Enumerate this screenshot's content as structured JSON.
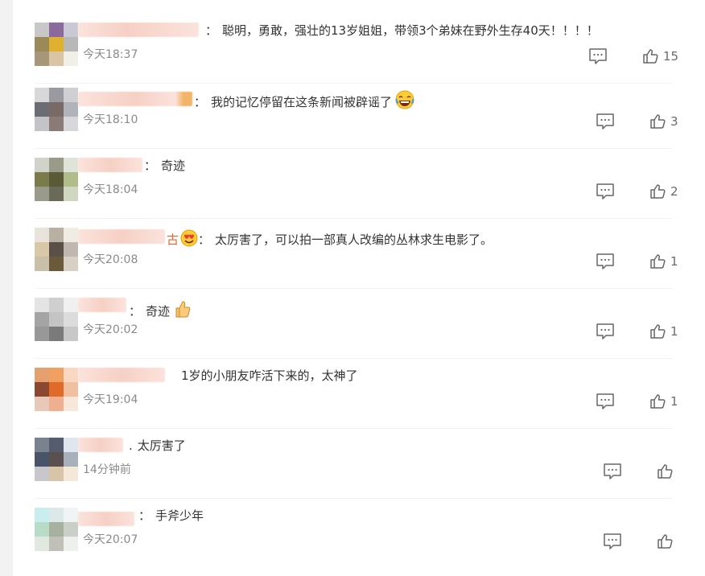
{
  "comments": [
    {
      "text": "聪明，勇敢，强壮的13岁姐姐，带领3个弟妹在野外生存40天！！！！",
      "time": "今天18:37",
      "likes": "15",
      "avatar_colors": [
        "#c8c8c8",
        "#8a6a9a",
        "#c9c9d6",
        "#9a8a5a",
        "#e0b030",
        "#b8b8b8",
        "#a8967a",
        "#d9c4a4",
        "#f0efe8"
      ],
      "name_blur_colors": [
        "#f6d6cc",
        "#fbe3dc"
      ]
    },
    {
      "text": "我的记忆停留在这条新闻被辟谣了",
      "emoji": "laugh-cry-emoji",
      "time": "今天18:10",
      "likes": "3",
      "avatar_colors": [
        "#d8d8d8",
        "#9a9aa0",
        "#d0d0d4",
        "#6a6e74",
        "#7a6a66",
        "#b0b4ba",
        "#c4c4c8",
        "#8a7a78",
        "#d8d8dc"
      ],
      "name_blur_colors": [
        "#f6d6cc",
        "#f3b46a"
      ]
    },
    {
      "text": "奇迹",
      "time": "今天18:04",
      "likes": "2",
      "avatar_colors": [
        "#d0d4c8",
        "#9a9a88",
        "#e0e4d8",
        "#7a7a4a",
        "#5a5a38",
        "#b0bc8a",
        "#9a9a8a",
        "#6a6a58",
        "#cfd7c0"
      ],
      "name_blur_colors": [
        "#f6d6cc",
        "#fbe3dc"
      ]
    },
    {
      "text": "太厉害了，可以拍一部真人改编的丛林求生电影了。",
      "prefix": "古",
      "prefix_emoji": "heart-eyes-emoji",
      "time": "今天20:08",
      "likes": "1",
      "avatar_colors": [
        "#e8e4dc",
        "#b8b0a0",
        "#f0ece4",
        "#d8c8a8",
        "#5a5048",
        "#c0b8b0",
        "#c8c0a8",
        "#6a5a3a",
        "#d8d0c4"
      ],
      "name_blur_colors": [
        "#f6d6cc",
        "#fbe3dc"
      ]
    },
    {
      "text": "奇迹",
      "emoji": "thumbs-up-emoji",
      "time": "今天20:02",
      "likes": "1",
      "avatar_colors": [
        "#e4e4e4",
        "#cfcfcf",
        "#f0f0f0",
        "#a4a4a4",
        "#c4c4c4",
        "#dcdcdc",
        "#989898",
        "#7a7a7a",
        "#c8c8c8"
      ],
      "name_blur_colors": [
        "#f6d6cc",
        "#fbe3dc"
      ]
    },
    {
      "text": "1岁的小朋友咋活下来的，太神了",
      "time": "今天19:04",
      "likes": "1",
      "avatar_colors": [
        "#e6a070",
        "#f0a060",
        "#f8d8c0",
        "#8a4830",
        "#e06a28",
        "#f0c0a0",
        "#e8c8b8",
        "#f0b090",
        "#f8e8dc"
      ],
      "name_blur_colors": [
        "#f6d6cc",
        "#fbe3dc"
      ]
    },
    {
      "text": "太厉害了",
      "time": "14分钟前",
      "likes": "",
      "avatar_colors": [
        "#7a8290",
        "#545c6e",
        "#dfe6ee",
        "#4a5468",
        "#5a5050",
        "#a8b0bc",
        "#c8c8cc",
        "#d8c4a8",
        "#f4e8d8"
      ],
      "name_blur_colors": [
        "#f6d6cc",
        "#fbe3dc"
      ]
    },
    {
      "text": "手斧少年",
      "time": "今天20:07",
      "likes": "",
      "avatar_colors": [
        "#c8eef0",
        "#dde8e8",
        "#f0f4f4",
        "#b8dcc8",
        "#a8b0a0",
        "#c8d0c8",
        "#e0e8e0",
        "#c0c0b8",
        "#eef0ee"
      ],
      "name_blur_colors": [
        "#f6d6cc",
        "#fbe3dc"
      ]
    }
  ],
  "icons": {
    "reply": "comment-icon",
    "like": "thumb-up-icon"
  },
  "colors": {
    "text": "#333333",
    "time": "#8a8a8a",
    "icon": "#666666",
    "prefix_orange": "#e8642a"
  }
}
